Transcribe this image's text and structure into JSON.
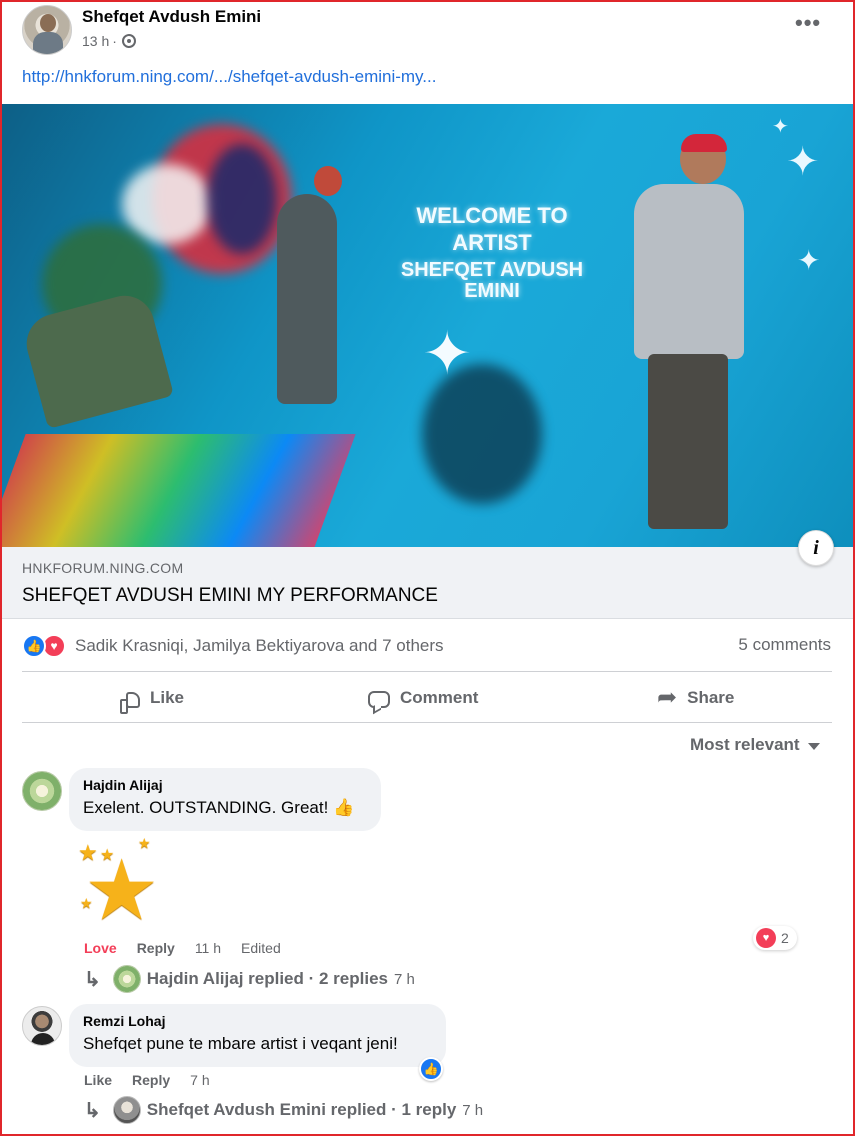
{
  "post": {
    "author": "Shefqet Avdush Emini",
    "time": "13 h",
    "separator": "·",
    "link_text": "http://hnkforum.ning.com/.../shefqet-avdush-emini-my..."
  },
  "image": {
    "welcome_line1": "WELCOME TO",
    "welcome_line2": "ARTIST",
    "welcome_line3": "SHEFQET AVDUSH EMINI"
  },
  "preview": {
    "domain": "HNKFORUM.NING.COM",
    "title": "SHEFQET AVDUSH EMINI MY PERFORMANCE"
  },
  "reactions": {
    "names": "Sadik Krasniqi, Jamilya Bektiyarova and 7 others",
    "comments_count": "5 comments"
  },
  "actions": {
    "like": "Like",
    "comment": "Comment",
    "share": "Share"
  },
  "sort": {
    "label": "Most relevant"
  },
  "comments": [
    {
      "name": "Hajdin Alijaj",
      "text": "Exelent. OUTSTANDING. Great!",
      "reaction_label": "Love",
      "reply_label": "Reply",
      "time": "11 h",
      "edited": "Edited",
      "reaction_count": "2",
      "replies_summary": "Hajdin Alijaj replied · 2 replies",
      "replies_time": "7 h"
    },
    {
      "name": "Remzi Lohaj",
      "text": "Shefqet pune te mbare artist i veqant jeni!",
      "like_label": "Like",
      "reply_label": "Reply",
      "time": "7 h",
      "replies_summary": "Shefqet Avdush Emini replied · 1 reply",
      "replies_time": "7 h"
    }
  ],
  "colors": {
    "link": "#216fdb",
    "secondary_text": "#65676b",
    "like_blue": "#1877f2",
    "love_red": "#f33e58",
    "bubble": "#f0f2f5",
    "frame": "#e0262b"
  },
  "icons": [
    "more-icon",
    "globe-icon",
    "info-icon",
    "like-reaction-icon",
    "love-reaction-icon",
    "thumbs-up-icon",
    "comment-icon",
    "share-icon",
    "caret-down-icon",
    "reply-arrow-icon",
    "stars-sticker"
  ]
}
